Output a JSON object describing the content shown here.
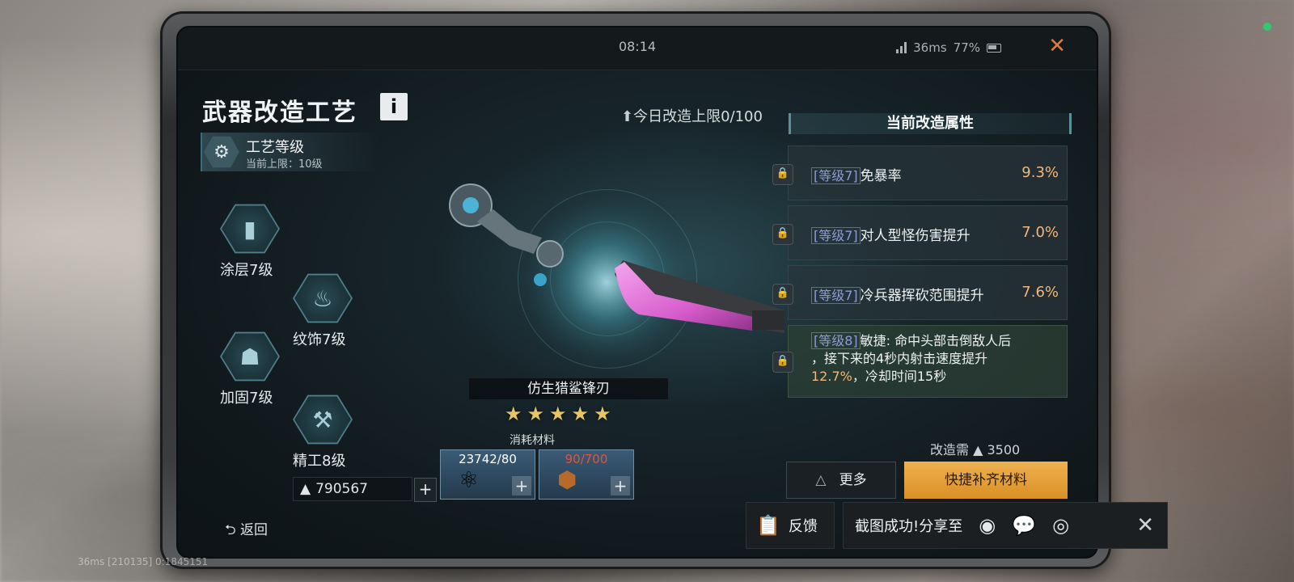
{
  "topbar": {
    "time": "08:14",
    "ping": "36ms",
    "battery": "77%"
  },
  "panel": {
    "title": "武器改造工艺",
    "info_icon": "i",
    "daily_cap": "今日改造上限0/100"
  },
  "craft_level": {
    "label": "工艺等级",
    "cap": "当前上限：10级"
  },
  "skills": [
    {
      "label": "涂层7级",
      "icon": "spray-can-icon"
    },
    {
      "label": "纹饰7级",
      "icon": "flame-pattern-icon"
    },
    {
      "label": "加固7级",
      "icon": "welding-mask-icon"
    },
    {
      "label": "精工8级",
      "icon": "drill-icon"
    }
  ],
  "currency": {
    "amount": "790567",
    "plus": "+"
  },
  "back_label": "返回",
  "weapon": {
    "name": "仿生猎鲨锋刃",
    "stars": 5
  },
  "materials": {
    "title": "消耗材料",
    "items": [
      {
        "count": "23742/80",
        "count_color": "#ffffff",
        "plus": "+"
      },
      {
        "count": "90/700",
        "count_color": "#e0553c",
        "plus": "+"
      }
    ]
  },
  "attributes": {
    "header": "当前改造属性",
    "rows": [
      {
        "tag": "[等级7]",
        "text": "免暴率",
        "value": "9.3%"
      },
      {
        "tag": "[等级7]",
        "text": "对人型怪伤害提升",
        "value": "7.0%"
      },
      {
        "tag": "[等级7]",
        "text": "冷兵器挥砍范围提升",
        "value": "7.6%"
      }
    ],
    "special": {
      "tag": "[等级8]",
      "line1": "敏捷: 命中头部击倒敌人后",
      "line2": "，接下来的4秒内射击速度提升",
      "highlight": "12.7%",
      "line3_rest": "，冷却时间15秒"
    }
  },
  "cost": {
    "label": "改造需",
    "amount": "3500"
  },
  "buttons": {
    "more": "更多",
    "quick_fill": "快捷补齐材料"
  },
  "feedback": {
    "label": "反馈"
  },
  "share": {
    "label": "截图成功!分享至"
  },
  "footer": {
    "ping": "36ms",
    "ids": "[210135] 0:1845151"
  }
}
